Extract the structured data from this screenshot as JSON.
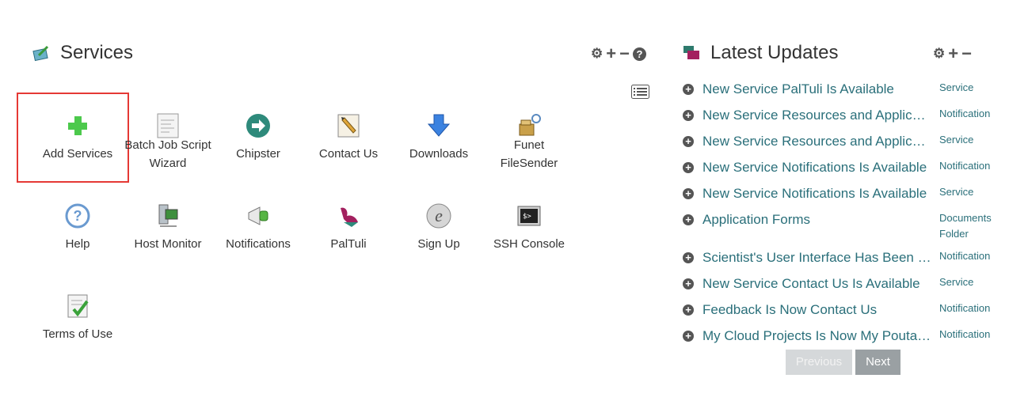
{
  "services_portlet": {
    "title": "Services",
    "items": [
      {
        "label": "Add Services",
        "icon": "plus-icon"
      },
      {
        "label": "Batch Job Script Wizard",
        "icon": "script-icon"
      },
      {
        "label": "Chipster",
        "icon": "chipster-arrow-icon"
      },
      {
        "label": "Contact Us",
        "icon": "contact-pen-icon"
      },
      {
        "label": "Downloads",
        "icon": "download-arrow-icon"
      },
      {
        "label": "Funet FileSender",
        "icon": "filesender-icon"
      },
      {
        "label": "Help",
        "icon": "help-icon"
      },
      {
        "label": "Host Monitor",
        "icon": "host-monitor-icon"
      },
      {
        "label": "Notifications",
        "icon": "megaphone-icon"
      },
      {
        "label": "PalTuli",
        "icon": "paltuli-icon"
      },
      {
        "label": "Sign Up",
        "icon": "signup-e-icon"
      },
      {
        "label": "SSH Console",
        "icon": "terminal-icon"
      },
      {
        "label": "Terms of Use",
        "icon": "checklist-icon"
      }
    ]
  },
  "updates_portlet": {
    "title": "Latest Updates",
    "items": [
      {
        "title": "New Service PalTuli Is Available",
        "type": "Service"
      },
      {
        "title": "New Service Resources and Applications Is Available",
        "type": "Notification"
      },
      {
        "title": "New Service Resources and Applications Is Available",
        "type": "Service"
      },
      {
        "title": "New Service Notifications Is Available",
        "type": "Notification"
      },
      {
        "title": "New Service Notifications Is Available",
        "type": "Service"
      },
      {
        "title": "Application Forms",
        "type": "Documents Folder"
      },
      {
        "title": "Scientist's User Interface Has Been Updated",
        "type": "Notification"
      },
      {
        "title": "New Service Contact Us Is Available",
        "type": "Service"
      },
      {
        "title": "Feedback Is Now Contact Us",
        "type": "Notification"
      },
      {
        "title": "My Cloud Projects Is Now My Pouta Projects",
        "type": "Notification"
      }
    ],
    "prev_label": "Previous",
    "next_label": "Next"
  },
  "colors": {
    "link": "#2a6f7a",
    "highlight": "#e53935"
  }
}
